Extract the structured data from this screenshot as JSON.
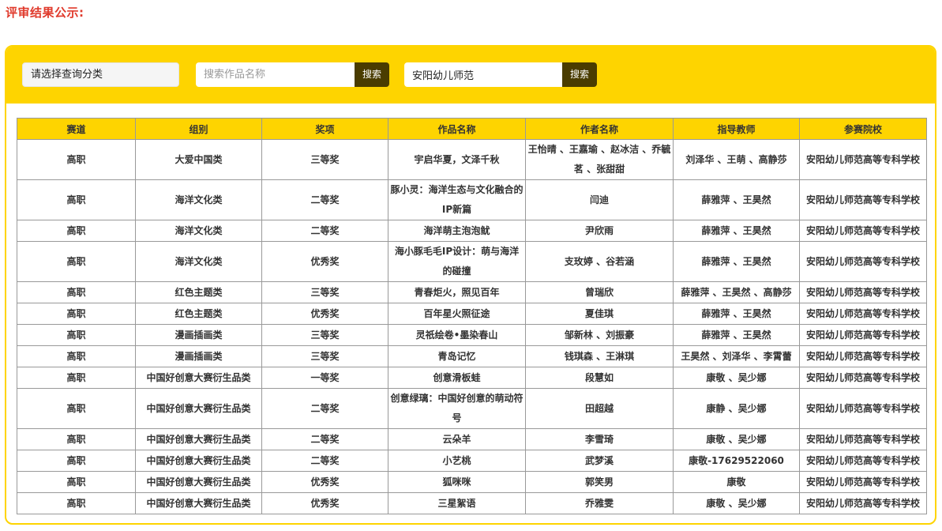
{
  "page": {
    "heading": "评审结果公示:"
  },
  "search": {
    "category_placeholder": "请选择查询分类",
    "name_placeholder": "搜索作品名称",
    "name_button": "搜索",
    "school_value": "安阳幼儿师范",
    "school_button": "搜索"
  },
  "table": {
    "headers": [
      "赛道",
      "组别",
      "奖项",
      "作品名称",
      "作者名称",
      "指导教师",
      "参赛院校"
    ],
    "rows": [
      [
        "高职",
        "大爱中国类",
        "三等奖",
        "宇启华夏，文泽千秋",
        "王怡晴 、王嘉瑜 、赵冰洁 、乔毓茗 、张甜甜",
        "刘泽华 、王萌 、高静莎",
        "安阳幼儿师范高等专科学校"
      ],
      [
        "高职",
        "海洋文化类",
        "二等奖",
        "豚小灵：海洋生态与文化融合的IP新篇",
        "闫迪",
        "薛雅萍 、王昊然",
        "安阳幼儿师范高等专科学校"
      ],
      [
        "高职",
        "海洋文化类",
        "二等奖",
        "海洋萌主泡泡鱿",
        "尹欣雨",
        "薛雅萍 、王昊然",
        "安阳幼儿师范高等专科学校"
      ],
      [
        "高职",
        "海洋文化类",
        "优秀奖",
        "海小豚毛毛IP设计：萌与海洋的碰撞",
        "支玫婷 、谷若涵",
        "薛雅萍 、王昊然",
        "安阳幼儿师范高等专科学校"
      ],
      [
        "高职",
        "红色主题类",
        "三等奖",
        "青春炬火，照见百年",
        "曾瑞欣",
        "薛雅萍 、王昊然 、高静莎",
        "安阳幼儿师范高等专科学校"
      ],
      [
        "高职",
        "红色主题类",
        "优秀奖",
        "百年星火照征途",
        "夏佳琪",
        "薛雅萍 、王昊然",
        "安阳幼儿师范高等专科学校"
      ],
      [
        "高职",
        "漫画插画类",
        "三等奖",
        "灵祇绘卷•墨染春山",
        "邹新林 、刘振豪",
        "薛雅萍 、王昊然",
        "安阳幼儿师范高等专科学校"
      ],
      [
        "高职",
        "漫画插画类",
        "三等奖",
        "青岛记忆",
        "钱琪森 、王淋琪",
        "王昊然 、刘泽华 、李霄蕾",
        "安阳幼儿师范高等专科学校"
      ],
      [
        "高职",
        "中国好创意大赛衍生品类",
        "一等奖",
        "创意滑板蛙",
        "段慧如",
        "康敬 、吴少娜",
        "安阳幼儿师范高等专科学校"
      ],
      [
        "高职",
        "中国好创意大赛衍生品类",
        "二等奖",
        "创意绿璃：中国好创意的萌动符号",
        "田超越",
        "康静 、吴少娜",
        "安阳幼儿师范高等专科学校"
      ],
      [
        "高职",
        "中国好创意大赛衍生品类",
        "二等奖",
        "云朵羊",
        "李雪琦",
        "康敬 、吴少娜",
        "安阳幼儿师范高等专科学校"
      ],
      [
        "高职",
        "中国好创意大赛衍生品类",
        "二等奖",
        "小艺桃",
        "武梦溪",
        "康敬-17629522060",
        "安阳幼儿师范高等专科学校"
      ],
      [
        "高职",
        "中国好创意大赛衍生品类",
        "优秀奖",
        "狐咪咪",
        "郭笑男",
        "康敬",
        "安阳幼儿师范高等专科学校"
      ],
      [
        "高职",
        "中国好创意大赛衍生品类",
        "优秀奖",
        "三星絮语",
        "乔雅雯",
        "康敬 、吴少娜",
        "安阳幼儿师范高等专科学校"
      ]
    ],
    "tall_rows": [
      0,
      1,
      3,
      9
    ]
  }
}
